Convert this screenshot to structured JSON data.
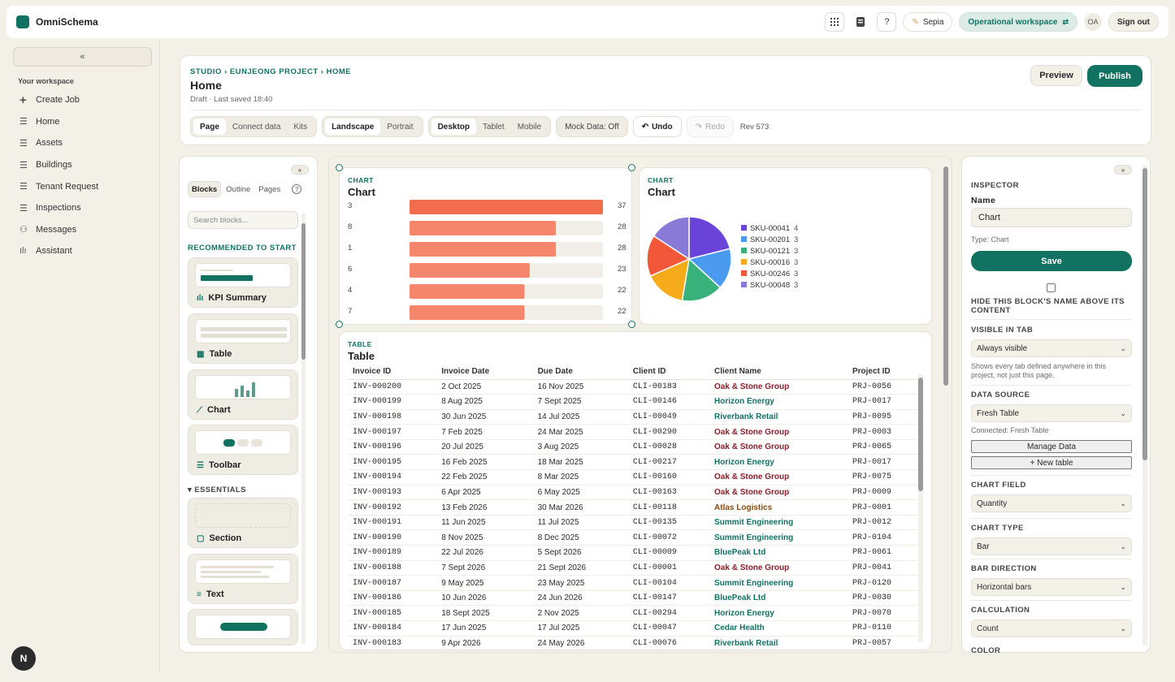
{
  "app": {
    "name": "OmniSchema"
  },
  "topbar": {
    "theme_label": "Sepia",
    "workspace_label": "Operational workspace",
    "avatar_initials": "OA",
    "signout_label": "Sign out",
    "help_label": "?"
  },
  "sidebar": {
    "collapse_label": "«",
    "workspace_title": "Your workspace",
    "items": [
      {
        "label": "Create Job",
        "icon": "plus-icon"
      },
      {
        "label": "Home",
        "icon": "list-icon"
      },
      {
        "label": "Assets",
        "icon": "list-icon"
      },
      {
        "label": "Buildings",
        "icon": "list-icon"
      },
      {
        "label": "Tenant Request",
        "icon": "list-icon"
      },
      {
        "label": "Inspections",
        "icon": "list-icon"
      },
      {
        "label": "Messages",
        "icon": "users-icon"
      },
      {
        "label": "Assistant",
        "icon": "bar-chart-icon"
      }
    ],
    "badge": "N"
  },
  "header": {
    "breadcrumb": "STUDIO › EUNJEONG PROJECT › HOME",
    "title": "Home",
    "subtitle": "Draft · Last saved 18:40",
    "preview_label": "Preview",
    "publish_label": "Publish",
    "group1": [
      "Page",
      "Connect data",
      "Kits"
    ],
    "group2": [
      "Landscape",
      "Portrait"
    ],
    "group3": [
      "Desktop",
      "Tablet",
      "Mobile"
    ],
    "mock_label": "Mock Data: Off",
    "undo_label": "Undo",
    "redo_label": "Redo",
    "rev_label": "Rev 573"
  },
  "library": {
    "collapse_label": "«",
    "tabs": [
      "Blocks",
      "Outline",
      "Pages"
    ],
    "search_placeholder": "Search blocks...",
    "recommended_title": "RECOMMENDED TO START",
    "essentials_title": "ESSENTIALS",
    "cards": [
      {
        "label": "KPI Summary",
        "icon": "bar-chart-icon"
      },
      {
        "label": "Table",
        "icon": "table-icon"
      },
      {
        "label": "Chart",
        "icon": "line-chart-icon"
      },
      {
        "label": "Toolbar",
        "icon": "toolbar-icon"
      },
      {
        "label": "Section",
        "icon": "section-icon"
      },
      {
        "label": "Text",
        "icon": "text-icon"
      }
    ]
  },
  "bar_panel": {
    "kicker": "CHART",
    "title": "Chart",
    "accent": "#f26d4f",
    "chart_data": {
      "type": "bar",
      "orientation": "horizontal",
      "categories": [
        "3",
        "8",
        "1",
        "6",
        "4",
        "7"
      ],
      "values": [
        37,
        28,
        28,
        23,
        22,
        22
      ],
      "xlim": [
        0,
        37
      ]
    }
  },
  "pie_panel": {
    "kicker": "CHART",
    "title": "Chart",
    "chart_data": {
      "type": "pie",
      "labels": [
        "SKU-00041",
        "SKU-00201",
        "SKU-00121",
        "SKU-00016",
        "SKU-00246",
        "SKU-00048"
      ],
      "values": [
        4,
        3,
        3,
        3,
        3,
        3
      ],
      "colors": [
        "#6a44d8",
        "#4a9af0",
        "#38b27a",
        "#f5ab1a",
        "#f2573a",
        "#8a7ad8"
      ],
      "legend": "right"
    }
  },
  "table_panel": {
    "kicker": "TABLE",
    "title": "Table",
    "columns": [
      "Invoice ID",
      "Invoice Date",
      "Due Date",
      "Client ID",
      "Client Name",
      "Project ID"
    ],
    "rows": [
      [
        "INV-000200",
        "2 Oct 2025",
        "16 Nov 2025",
        "CLI-00183",
        "Oak & Stone Group",
        "PRJ-0056"
      ],
      [
        "INV-000199",
        "8 Aug 2025",
        "7 Sept 2025",
        "CLI-00146",
        "Horizon Energy",
        "PRJ-0017"
      ],
      [
        "INV-000198",
        "30 Jun 2025",
        "14 Jul 2025",
        "CLI-00049",
        "Riverbank Retail",
        "PRJ-0095"
      ],
      [
        "INV-000197",
        "7 Feb 2025",
        "24 Mar 2025",
        "CLI-00290",
        "Oak & Stone Group",
        "PRJ-0003"
      ],
      [
        "INV-000196",
        "20 Jul 2025",
        "3 Aug 2025",
        "CLI-00028",
        "Oak & Stone Group",
        "PRJ-0065"
      ],
      [
        "INV-000195",
        "16 Feb 2025",
        "18 Mar 2025",
        "CLI-00217",
        "Horizon Energy",
        "PRJ-0017"
      ],
      [
        "INV-000194",
        "22 Feb 2025",
        "8 Mar 2025",
        "CLI-00160",
        "Oak & Stone Group",
        "PRJ-0075"
      ],
      [
        "INV-000193",
        "6 Apr 2025",
        "6 May 2025",
        "CLI-00163",
        "Oak & Stone Group",
        "PRJ-0009"
      ],
      [
        "INV-000192",
        "13 Feb 2026",
        "30 Mar 2026",
        "CLI-00118",
        "Atlas Logistics",
        "PRJ-0001"
      ],
      [
        "INV-000191",
        "11 Jun 2025",
        "11 Jul 2025",
        "CLI-00135",
        "Summit Engineering",
        "PRJ-0012"
      ],
      [
        "INV-000190",
        "8 Nov 2025",
        "8 Dec 2025",
        "CLI-00072",
        "Summit Engineering",
        "PRJ-0104"
      ],
      [
        "INV-000189",
        "22 Jul 2026",
        "5 Sept 2026",
        "CLI-00009",
        "BluePeak Ltd",
        "PRJ-0061"
      ],
      [
        "INV-000188",
        "7 Sept 2026",
        "21 Sept 2026",
        "CLI-00001",
        "Oak & Stone Group",
        "PRJ-0041"
      ],
      [
        "INV-000187",
        "9 May 2025",
        "23 May 2025",
        "CLI-00104",
        "Summit Engineering",
        "PRJ-0120"
      ],
      [
        "INV-000186",
        "10 Jun 2026",
        "24 Jun 2026",
        "CLI-00147",
        "BluePeak Ltd",
        "PRJ-0030"
      ],
      [
        "INV-000185",
        "18 Sept 2025",
        "2 Nov 2025",
        "CLI-00294",
        "Horizon Energy",
        "PRJ-0070"
      ],
      [
        "INV-000184",
        "17 Jun 2025",
        "17 Jul 2025",
        "CLI-00047",
        "Cedar Health",
        "PRJ-0110"
      ],
      [
        "INV-000183",
        "9 Apr 2026",
        "24 May 2026",
        "CLI-00076",
        "Riverbank Retail",
        "PRJ-0057"
      ]
    ],
    "client_colors": {
      "Oak & Stone Group": "#8a1f2b",
      "Horizon Energy": "#127262",
      "Riverbank Retail": "#127262",
      "Atlas Logistics": "#8a4a12",
      "Summit Engineering": "#127262",
      "BluePeak Ltd": "#127262",
      "Cedar Health": "#127262"
    }
  },
  "inspector": {
    "expand_label": "»",
    "title": "INSPECTOR",
    "name_label": "Name",
    "name_value": "Chart",
    "type_text": "Type: Chart",
    "save_label": "Save",
    "hide_name_label": "HIDE THIS BLOCK'S NAME ABOVE ITS CONTENT",
    "visible_label": "VISIBLE IN TAB",
    "visible_value": "Always visible",
    "visible_note": "Shows every tab defined anywhere in this project, not just this page.",
    "data_source_label": "DATA SOURCE",
    "data_source_value": "Fresh Table",
    "connected_text": "Connected: Fresh Table",
    "manage_label": "Manage Data",
    "new_table_label": "+ New table",
    "chart_field_label": "CHART FIELD",
    "chart_field_value": "Quantity",
    "chart_type_label": "CHART TYPE",
    "chart_type_value": "Bar",
    "bar_direction_label": "BAR DIRECTION",
    "bar_direction_value": "Horizontal bars",
    "calculation_label": "CALCULATION",
    "calculation_value": "Count",
    "color_label": "COLOR"
  }
}
